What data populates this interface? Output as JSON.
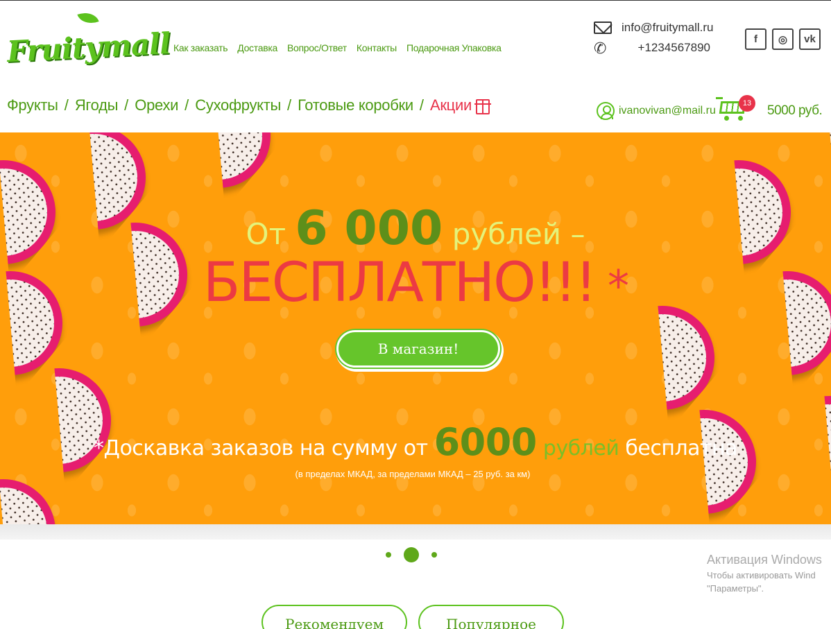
{
  "header": {
    "logo_text": "Fruitymall",
    "nav": [
      "Как заказать",
      "Доставка",
      "Вопрос/Ответ",
      "Контакты",
      "Подарочная Упаковка"
    ],
    "contact": {
      "email": "info@fruitymall.ru",
      "phone": "+1234567890",
      "email_icon": "mail-icon",
      "phone_icon": "phone-icon"
    },
    "social": [
      {
        "name": "facebook-icon",
        "glyph": "f"
      },
      {
        "name": "instagram-icon",
        "glyph": "◎"
      },
      {
        "name": "vk-icon",
        "glyph": "vk"
      }
    ]
  },
  "categories": {
    "items": [
      "Фрукты",
      "Ягоды",
      "Орехи",
      "Сухофрукты",
      "Готовые коробки"
    ],
    "separator": "/",
    "promo": "Акции"
  },
  "account": {
    "email": "ivanovivan@mail.ru"
  },
  "cart": {
    "count": "13",
    "total": "5000 руб."
  },
  "hero": {
    "line1_prefix": "От ",
    "line1_amount": "6 000",
    "line1_suffix": " рублей –",
    "free": "БЕСПЛАТНО!!!",
    "free_star": " *",
    "button": "В магазин!",
    "note_prefix": "*Доскавка заказов на сумму от ",
    "note_amount": "6000",
    "note_rub": " рублей",
    "note_suffix": " бесплатна",
    "sub": "(в пределах МКАД, за пределами МКАД – 25 руб. за км)"
  },
  "slider": {
    "slides": 3,
    "active": 2
  },
  "watermark": {
    "title": "Активация Windows",
    "line1": "Чтобы активировать Wind",
    "line2": "\"Параметры\"."
  },
  "tabs": [
    "Рекомендуем",
    "Популярное"
  ],
  "colors": {
    "green": "#5cc21e",
    "dark_green": "#4b9a12",
    "red": "#e8334a",
    "orange": "#ff9e0b",
    "pitaya": "#e61d6f"
  }
}
